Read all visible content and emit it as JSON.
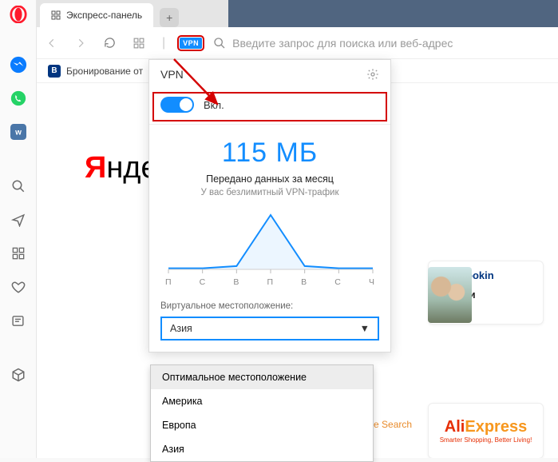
{
  "tab": {
    "title": "Экспресс-панель"
  },
  "addressbar": {
    "vpn_label": "VPN",
    "placeholder": "Введите запрос для поиска или веб-адрес"
  },
  "bookmark": {
    "icon_letter": "B",
    "label": "Бронирование от"
  },
  "page": {
    "yandex_html": "Янде",
    "booking": {
      "icon_letter": "B",
      "brand": "Bookin",
      "promo": "Скидки"
    },
    "aliexpress": {
      "line1a": "Ali",
      "line1b": "Express",
      "line2": "Smarter Shopping, Better Living!"
    },
    "goog": "Google Search"
  },
  "vpn": {
    "title": "VPN",
    "toggle_label": "Вкл.",
    "usage_value": "115 МБ",
    "usage_sub": "Передано данных за месяц",
    "usage_note": "У вас безлимитный VPN-трафик",
    "days": [
      "П",
      "С",
      "В",
      "П",
      "В",
      "С",
      "Ч"
    ],
    "location_label": "Виртуальное местоположение:",
    "selected": "Азия",
    "options": [
      "Оптимальное местоположение",
      "Америка",
      "Европа",
      "Азия"
    ]
  },
  "chart_data": {
    "type": "line",
    "categories": [
      "П",
      "С",
      "В",
      "П",
      "В",
      "С",
      "Ч"
    ],
    "values": [
      2,
      2,
      6,
      100,
      6,
      2,
      2
    ],
    "title": "",
    "xlabel": "",
    "ylabel": "",
    "ylim": [
      0,
      100
    ]
  }
}
